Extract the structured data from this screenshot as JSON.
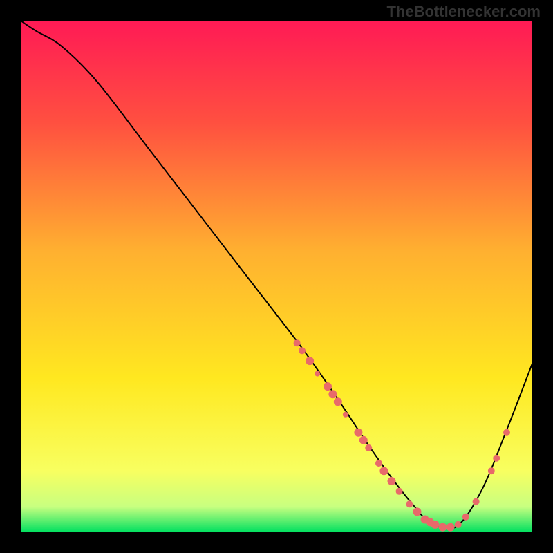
{
  "watermark": "TheBottlenecker.com",
  "chart_data": {
    "type": "line",
    "title": "",
    "xlabel": "",
    "ylabel": "",
    "xlim": [
      0,
      100
    ],
    "ylim": [
      0,
      100
    ],
    "grid": false,
    "legend": false,
    "background_gradient": {
      "stops": [
        {
          "offset": 0,
          "color": "#ff1a55"
        },
        {
          "offset": 20,
          "color": "#ff5040"
        },
        {
          "offset": 45,
          "color": "#ffb030"
        },
        {
          "offset": 70,
          "color": "#ffe820"
        },
        {
          "offset": 88,
          "color": "#f8ff60"
        },
        {
          "offset": 95,
          "color": "#c8ff80"
        },
        {
          "offset": 100,
          "color": "#00e060"
        }
      ]
    },
    "curve": {
      "color": "#000000",
      "x": [
        0,
        3,
        8,
        15,
        25,
        35,
        45,
        55,
        62,
        68,
        73,
        77,
        80,
        85,
        90,
        95,
        100
      ],
      "y": [
        100,
        98,
        95,
        88,
        75,
        62,
        49,
        36,
        26,
        17,
        10,
        5,
        2,
        1,
        8,
        20,
        33
      ]
    },
    "markers": {
      "color": "#e86a6a",
      "radius_small": 4,
      "radius_large": 6,
      "points": [
        {
          "x": 54,
          "y": 37,
          "r": 5
        },
        {
          "x": 55,
          "y": 35.5,
          "r": 5
        },
        {
          "x": 56.5,
          "y": 33.5,
          "r": 6
        },
        {
          "x": 58,
          "y": 31,
          "r": 4
        },
        {
          "x": 60,
          "y": 28.5,
          "r": 6
        },
        {
          "x": 61,
          "y": 27,
          "r": 6
        },
        {
          "x": 62,
          "y": 25.5,
          "r": 6
        },
        {
          "x": 63.5,
          "y": 23,
          "r": 4
        },
        {
          "x": 66,
          "y": 19.5,
          "r": 6
        },
        {
          "x": 67,
          "y": 18,
          "r": 6
        },
        {
          "x": 68,
          "y": 16.5,
          "r": 5
        },
        {
          "x": 70,
          "y": 13.5,
          "r": 5
        },
        {
          "x": 71,
          "y": 12,
          "r": 6
        },
        {
          "x": 72.5,
          "y": 10,
          "r": 6
        },
        {
          "x": 74,
          "y": 8,
          "r": 5
        },
        {
          "x": 76,
          "y": 5.5,
          "r": 5
        },
        {
          "x": 77.5,
          "y": 4,
          "r": 6
        },
        {
          "x": 79,
          "y": 2.5,
          "r": 6
        },
        {
          "x": 80,
          "y": 2,
          "r": 6
        },
        {
          "x": 81,
          "y": 1.5,
          "r": 6
        },
        {
          "x": 82.5,
          "y": 1,
          "r": 6
        },
        {
          "x": 84,
          "y": 1,
          "r": 6
        },
        {
          "x": 85.5,
          "y": 1.5,
          "r": 5
        },
        {
          "x": 87,
          "y": 3,
          "r": 5
        },
        {
          "x": 89,
          "y": 6,
          "r": 5
        },
        {
          "x": 92,
          "y": 12,
          "r": 5
        },
        {
          "x": 93,
          "y": 14.5,
          "r": 5
        },
        {
          "x": 95,
          "y": 19.5,
          "r": 5
        }
      ]
    }
  }
}
